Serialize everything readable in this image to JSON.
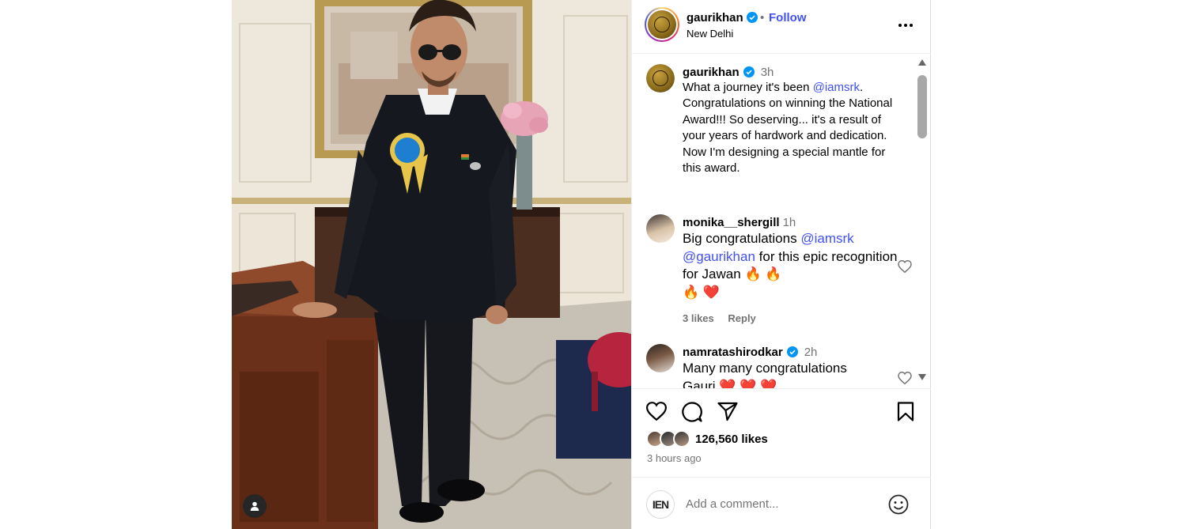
{
  "post": {
    "username": "gaurikhan",
    "verified": true,
    "separator": "•",
    "follow_label": "Follow",
    "location": "New Delhi",
    "more_icon": "more-options-icon"
  },
  "caption": {
    "username": "gaurikhan",
    "time": "3h",
    "text_1": "What a journey it's been ",
    "mention": "@iamsrk",
    "text_2": ". Congratulations on winning the National Award!!! So deserving... it's a result of your years of hardwork and dedication. Now I'm designing a special mantle for this award."
  },
  "comments": [
    {
      "username": "monika__shergill",
      "time": "1h",
      "text_1": "Big congratulations ",
      "mention_1": "@iamsrk",
      "mention_2": "@gaurikhan",
      "text_2": " for this epic recognition for Jawan ",
      "emojis_1": "🔥 🔥",
      "emojis_2": "🔥 ❤️",
      "likes_label": "3 likes",
      "reply_label": "Reply"
    },
    {
      "username": "namratashirodkar",
      "verified": true,
      "time": "2h",
      "text": "Many many congratulations",
      "text_cut": "Gauri ❤️ ❤️ ❤️"
    }
  ],
  "actions": {
    "like_icon": "heart-icon",
    "comment_icon": "comment-icon",
    "share_icon": "share-icon",
    "save_icon": "bookmark-icon",
    "likes_count": "126,560 likes",
    "posted_ago": "3 hours ago"
  },
  "add_comment": {
    "placeholder": "Add a comment...",
    "avatar_text": "IEN",
    "emoji_icon": "emoji-icon"
  },
  "colors": {
    "link_blue": "#4150f7",
    "verified_blue": "#0095f6",
    "muted_text": "#737373"
  }
}
